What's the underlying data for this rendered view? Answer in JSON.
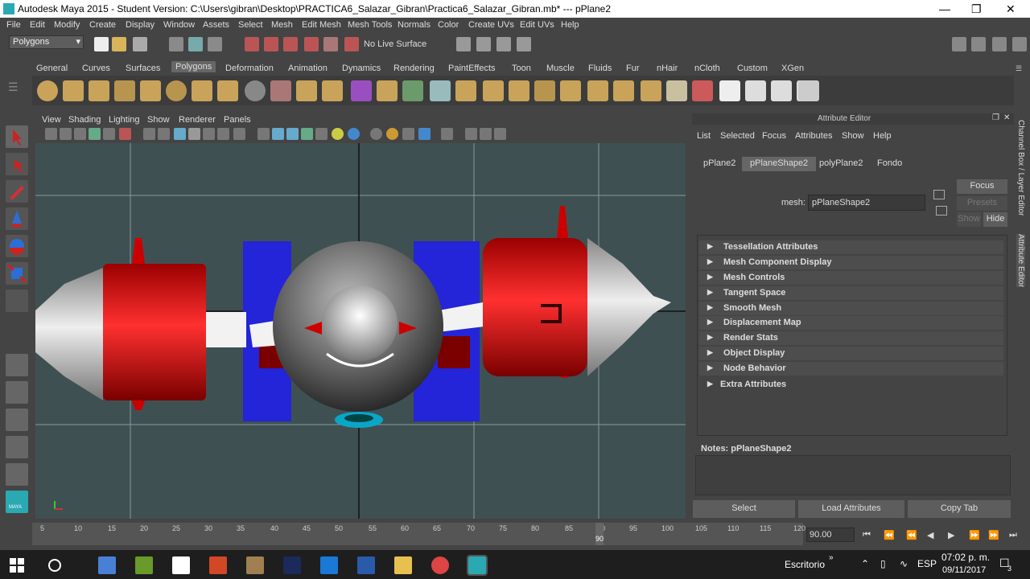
{
  "window": {
    "title": "Autodesk Maya 2015 - Student Version: C:\\Users\\gibran\\Desktop\\PRACTICA6_Salazar_Gibran\\Practica6_Salazar_Gibran.mb*  ---  pPlane2"
  },
  "menubar": [
    "File",
    "Edit",
    "Modify",
    "Create",
    "Display",
    "Window",
    "Assets",
    "Select",
    "Mesh",
    "Edit Mesh",
    "Mesh Tools",
    "Normals",
    "Color",
    "Create UVs",
    "Edit UVs",
    "Help"
  ],
  "statusline": {
    "menuset": "Polygons",
    "live_surface": "No Live Surface"
  },
  "shelf_tabs": [
    "General",
    "Curves",
    "Surfaces",
    "Polygons",
    "Deformation",
    "Animation",
    "Dynamics",
    "Rendering",
    "PaintEffects",
    "Toon",
    "Muscle",
    "Fluids",
    "Fur",
    "nHair",
    "nCloth",
    "Custom",
    "XGen"
  ],
  "shelf_active": "Polygons",
  "panel_menu": [
    "View",
    "Shading",
    "Lighting",
    "Show",
    "Renderer",
    "Panels"
  ],
  "attribute_editor": {
    "header": "Attribute Editor",
    "menu": [
      "List",
      "Selected",
      "Focus",
      "Attributes",
      "Show",
      "Help"
    ],
    "tabs": [
      "pPlane2",
      "pPlaneShape2",
      "polyPlane2",
      "Fondo"
    ],
    "active_tab": "pPlaneShape2",
    "mesh_label": "mesh:",
    "mesh_value": "pPlaneShape2",
    "buttons": {
      "focus": "Focus",
      "presets": "Presets",
      "show": "Show",
      "hide": "Hide"
    },
    "sections": [
      "Tessellation Attributes",
      "Mesh Component Display",
      "Mesh Controls",
      "Tangent Space",
      "Smooth Mesh",
      "Displacement Map",
      "Render Stats",
      "Object Display",
      "Node Behavior",
      "Extra Attributes"
    ],
    "notes_label": "Notes:  pPlaneShape2",
    "bottom_buttons": [
      "Select",
      "Load Attributes",
      "Copy Tab"
    ]
  },
  "side_tabs": [
    "Channel Box / Layer Editor",
    "Attribute Editor"
  ],
  "timeline": {
    "ticks": [
      "5",
      "10",
      "15",
      "20",
      "25",
      "30",
      "35",
      "40",
      "45",
      "50",
      "55",
      "60",
      "65",
      "70",
      "75",
      "80",
      "85",
      "90",
      "95",
      "100",
      "105",
      "110",
      "115",
      "120"
    ],
    "current_frame": "90",
    "end_field": "90.00"
  },
  "taskbar": {
    "desktop_label": "Escritorio",
    "lang": "ESP",
    "time": "07:02 p. m.",
    "date": "09/11/2017",
    "notifications": "3"
  },
  "maya_label": "MAYA"
}
